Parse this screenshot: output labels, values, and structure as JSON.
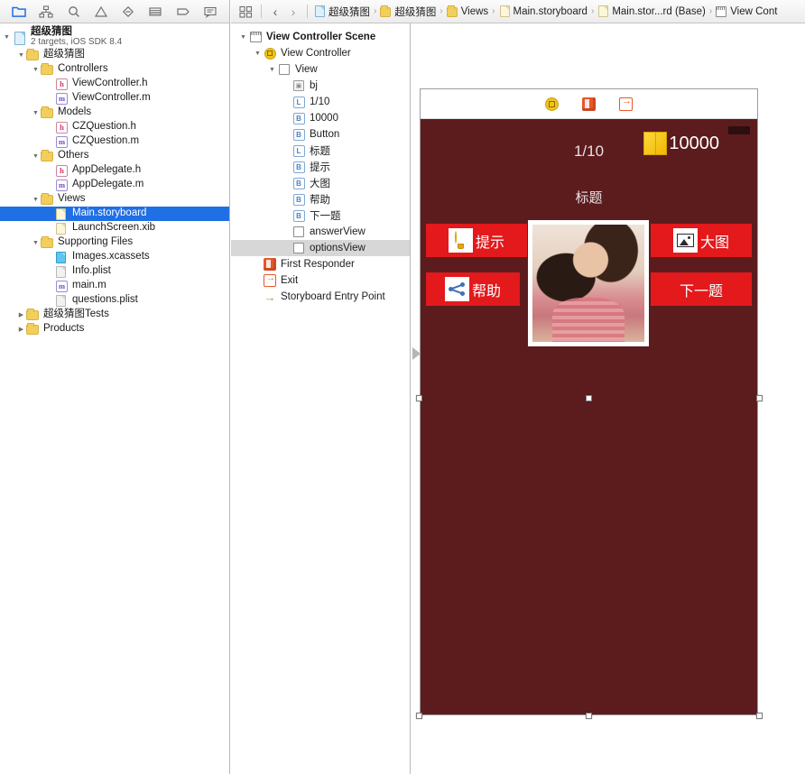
{
  "navigator": {
    "toolbar": [
      {
        "name": "project-navigator-icon",
        "glyph": "folder",
        "active": true
      },
      {
        "name": "source-control-navigator-icon",
        "glyph": "hierarchy",
        "active": false
      },
      {
        "name": "symbol-navigator-icon",
        "glyph": "search",
        "active": false
      },
      {
        "name": "issue-navigator-icon",
        "glyph": "warning",
        "active": false
      },
      {
        "name": "test-navigator-icon",
        "glyph": "diamond",
        "active": false
      },
      {
        "name": "debug-navigator-icon",
        "glyph": "list",
        "active": false
      },
      {
        "name": "breakpoint-navigator-icon",
        "glyph": "tag",
        "active": false
      },
      {
        "name": "report-navigator-icon",
        "glyph": "report",
        "active": false
      }
    ],
    "project": {
      "title": "超级猜图",
      "subtitle": "2 targets, iOS SDK 8.4"
    },
    "tree": [
      {
        "label": "超级猜图",
        "depth": 1,
        "icon": "folder",
        "state": "open"
      },
      {
        "label": "Controllers",
        "depth": 2,
        "icon": "folder",
        "state": "open"
      },
      {
        "label": "ViewController.h",
        "depth": 3,
        "icon": "h"
      },
      {
        "label": "ViewController.m",
        "depth": 3,
        "icon": "m"
      },
      {
        "label": "Models",
        "depth": 2,
        "icon": "folder",
        "state": "open"
      },
      {
        "label": "CZQuestion.h",
        "depth": 3,
        "icon": "h"
      },
      {
        "label": "CZQuestion.m",
        "depth": 3,
        "icon": "m"
      },
      {
        "label": "Others",
        "depth": 2,
        "icon": "folder",
        "state": "open"
      },
      {
        "label": "AppDelegate.h",
        "depth": 3,
        "icon": "h"
      },
      {
        "label": "AppDelegate.m",
        "depth": 3,
        "icon": "m"
      },
      {
        "label": "Views",
        "depth": 2,
        "icon": "folder",
        "state": "open"
      },
      {
        "label": "Main.storyboard",
        "depth": 3,
        "icon": "doc-yellow",
        "selected": true
      },
      {
        "label": "LaunchScreen.xib",
        "depth": 3,
        "icon": "doc-yellow"
      },
      {
        "label": "Supporting Files",
        "depth": 2,
        "icon": "folder",
        "state": "open"
      },
      {
        "label": "Images.xcassets",
        "depth": 3,
        "icon": "xcassets"
      },
      {
        "label": "Info.plist",
        "depth": 3,
        "icon": "doc-grey"
      },
      {
        "label": "main.m",
        "depth": 3,
        "icon": "m"
      },
      {
        "label": "questions.plist",
        "depth": 3,
        "icon": "doc-grey"
      },
      {
        "label": "超级猜图Tests",
        "depth": 1,
        "icon": "folder",
        "state": "closed"
      },
      {
        "label": "Products",
        "depth": 1,
        "icon": "folder",
        "state": "closed"
      }
    ]
  },
  "breadcrumb": {
    "grid_icon": "assistant-editor-icon",
    "back_label": "‹",
    "forward_label": "›",
    "items": [
      {
        "label": "超级猜图",
        "icon": "project-icon"
      },
      {
        "label": "超级猜图",
        "icon": "folder-icon"
      },
      {
        "label": "Views",
        "icon": "folder-icon"
      },
      {
        "label": "Main.storyboard",
        "icon": "storyboard-icon"
      },
      {
        "label": "Main.stor...rd (Base)",
        "icon": "storyboard-icon"
      },
      {
        "label": "View Cont",
        "icon": "scene-icon"
      }
    ]
  },
  "outline": {
    "items": [
      {
        "label": "View Controller Scene",
        "depth": 0,
        "icon": "scene",
        "state": "open",
        "bold": true
      },
      {
        "label": "View Controller",
        "depth": 1,
        "icon": "viewcontroller",
        "state": "open"
      },
      {
        "label": "View",
        "depth": 2,
        "icon": "view",
        "state": "open"
      },
      {
        "label": "bj",
        "depth": 3,
        "icon": "imageview"
      },
      {
        "label": "1/10",
        "depth": 3,
        "icon": "label"
      },
      {
        "label": "10000",
        "depth": 3,
        "icon": "button"
      },
      {
        "label": "Button",
        "depth": 3,
        "icon": "button"
      },
      {
        "label": "标题",
        "depth": 3,
        "icon": "label"
      },
      {
        "label": "提示",
        "depth": 3,
        "icon": "button"
      },
      {
        "label": "大图",
        "depth": 3,
        "icon": "button"
      },
      {
        "label": "帮助",
        "depth": 3,
        "icon": "button"
      },
      {
        "label": "下一题",
        "depth": 3,
        "icon": "button"
      },
      {
        "label": "answerView",
        "depth": 3,
        "icon": "view"
      },
      {
        "label": "optionsView",
        "depth": 3,
        "icon": "view",
        "selected": true
      },
      {
        "label": "First Responder",
        "depth": 1,
        "icon": "firstresponder"
      },
      {
        "label": "Exit",
        "depth": 1,
        "icon": "exit"
      },
      {
        "label": "Storyboard Entry Point",
        "depth": 1,
        "icon": "entrypoint"
      }
    ]
  },
  "scene": {
    "topbar_icons": [
      {
        "name": "view-controller-icon"
      },
      {
        "name": "first-responder-icon"
      },
      {
        "name": "exit-icon"
      }
    ],
    "progress": "1/10",
    "title": "标题",
    "coin_value": "10000",
    "background_color": "#5c1c1e",
    "button_color": "#e3191c",
    "buttons": [
      {
        "label": "提示",
        "icon": "lightbulb-icon",
        "name": "hint-button"
      },
      {
        "label": "大图",
        "icon": "picture-icon",
        "name": "bigimage-button"
      },
      {
        "label": "帮助",
        "icon": "share-icon",
        "name": "help-button"
      },
      {
        "label": "下一题",
        "icon": "",
        "name": "next-question-button"
      }
    ],
    "photo_alt": "question-image"
  }
}
